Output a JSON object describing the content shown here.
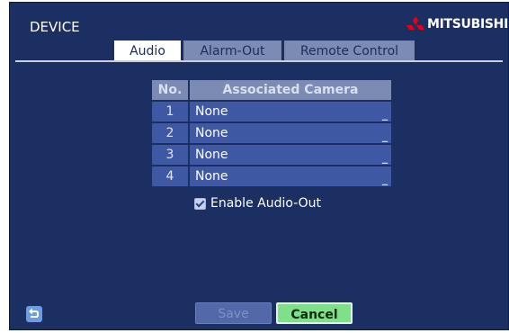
{
  "window": {
    "title": "DEVICE",
    "brand": "MITSUBISHI",
    "brand_color": "#e60012"
  },
  "tabs": [
    {
      "label": "Audio",
      "active": true
    },
    {
      "label": "Alarm-Out",
      "active": false
    },
    {
      "label": "Remote Control",
      "active": false
    }
  ],
  "table": {
    "headers": {
      "no": "No.",
      "camera": "Associated Camera"
    },
    "rows": [
      {
        "no": "1",
        "camera": "None"
      },
      {
        "no": "2",
        "camera": "None"
      },
      {
        "no": "3",
        "camera": "None"
      },
      {
        "no": "4",
        "camera": "None"
      }
    ],
    "dropdown_icon": "chevron-down-icon"
  },
  "enable_audio_out": {
    "label": "Enable Audio-Out",
    "checked": true
  },
  "footer": {
    "back_icon": "back-icon",
    "save_label": "Save",
    "cancel_label": "Cancel"
  },
  "colors": {
    "background": "#1c2f63",
    "cell": "#3e58a3",
    "header": "#7b8bb3",
    "cancel": "#7fe08a"
  }
}
